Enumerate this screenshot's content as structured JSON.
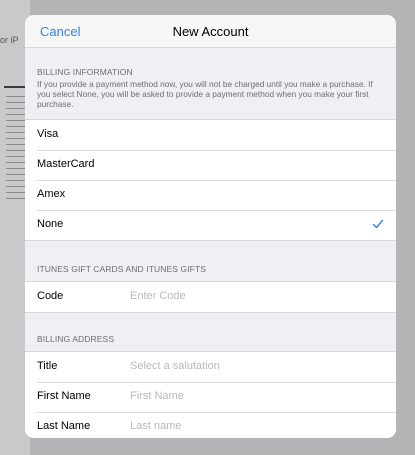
{
  "background": {
    "snippet": "or iP"
  },
  "navbar": {
    "cancel_label": "Cancel",
    "title": "New Account"
  },
  "billing": {
    "header": "BILLING INFORMATION",
    "description": "If you provide a payment method now, you will not be charged until you make a purchase. If you select None, you will be asked to provide a payment method when you make your first purchase.",
    "options": [
      {
        "label": "Visa",
        "selected": false
      },
      {
        "label": "MasterCard",
        "selected": false
      },
      {
        "label": "Amex",
        "selected": false
      },
      {
        "label": "None",
        "selected": true
      }
    ]
  },
  "gift": {
    "header": "ITUNES GIFT CARDS AND ITUNES GIFTS",
    "code_label": "Code",
    "code_placeholder": "Enter Code"
  },
  "address": {
    "header": "BILLING ADDRESS",
    "fields": [
      {
        "label": "Title",
        "placeholder": "Select a salutation"
      },
      {
        "label": "First Name",
        "placeholder": "First Name"
      },
      {
        "label": "Last Name",
        "placeholder": "Last name"
      }
    ]
  },
  "colors": {
    "accent": "#2f7ff0",
    "sheet_bg": "#efeff4",
    "placeholder": "#b9b9be"
  }
}
